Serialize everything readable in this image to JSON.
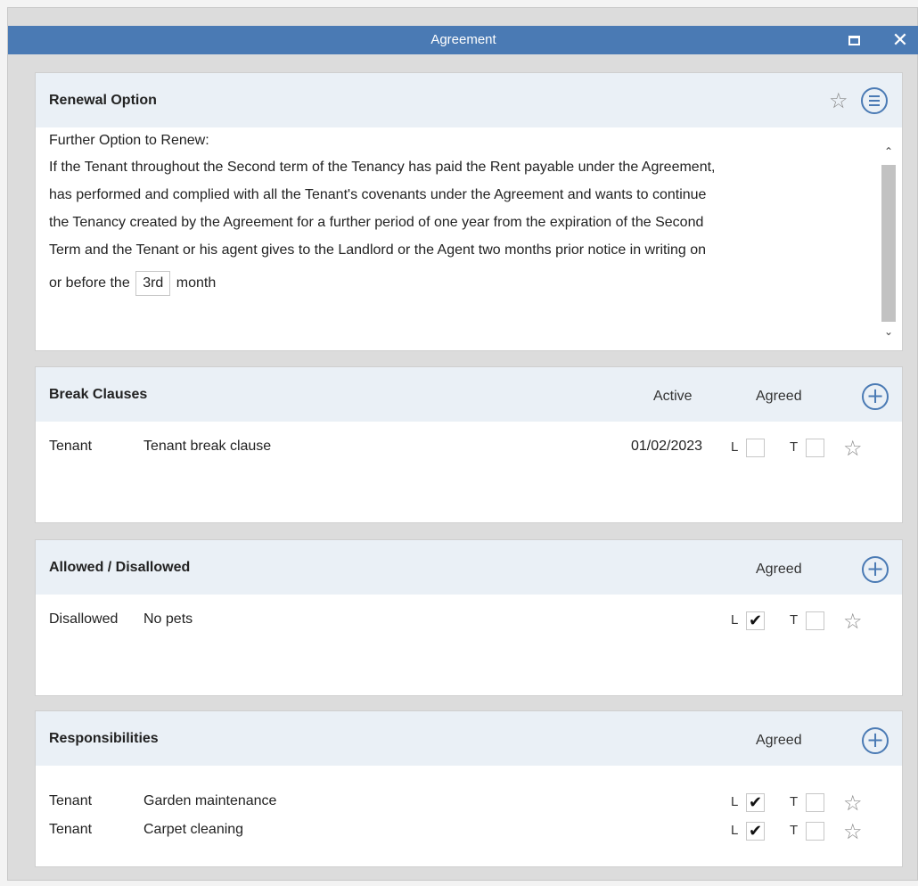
{
  "window": {
    "title": "Agreement"
  },
  "renewal": {
    "title": "Renewal Option",
    "lines": [
      "Further Option to Renew:",
      "If the Tenant throughout the Second term of the Tenancy has paid the Rent payable under the Agreement,",
      "has performed and complied with all the Tenant's covenants under the Agreement and wants to continue",
      "the Tenancy created by the Agreement for a further period of one year from the expiration of the Second",
      "Term and the Tenant or his agent gives to the Landlord or the Agent two months prior notice in writing on"
    ],
    "last_line_prefix": "or before the",
    "month_value": "3rd",
    "last_line_suffix": "month",
    "icons": {
      "favorite": "star-outline-icon",
      "menu": "menu-lines-icon"
    }
  },
  "break_clauses": {
    "title": "Break Clauses",
    "col_active": "Active",
    "col_agreed": "Agreed",
    "rows": [
      {
        "party": "Tenant",
        "description": "Tenant break clause",
        "active": "01/02/2023",
        "l_label": "L",
        "t_label": "T",
        "l_checked": false,
        "t_checked": false
      }
    ]
  },
  "allowed": {
    "title": "Allowed / Disallowed",
    "col_agreed": "Agreed",
    "rows": [
      {
        "type": "Disallowed",
        "description": "No pets",
        "l_label": "L",
        "t_label": "T",
        "l_checked": true,
        "t_checked": false
      }
    ]
  },
  "responsibilities": {
    "title": "Responsibilities",
    "col_agreed": "Agreed",
    "rows": [
      {
        "party": "Tenant",
        "description": "Garden maintenance",
        "l_label": "L",
        "t_label": "T",
        "l_checked": true,
        "t_checked": false
      },
      {
        "party": "Tenant",
        "description": "Carpet cleaning",
        "l_label": "L",
        "t_label": "T",
        "l_checked": true,
        "t_checked": false
      }
    ]
  },
  "glyphs": {
    "star": "☆",
    "check": "✔",
    "plus": "+",
    "close": "✕",
    "up": "⌃",
    "down": "⌄"
  },
  "colors": {
    "accent": "#4a7ab4",
    "header_bg": "#eaf0f6"
  }
}
